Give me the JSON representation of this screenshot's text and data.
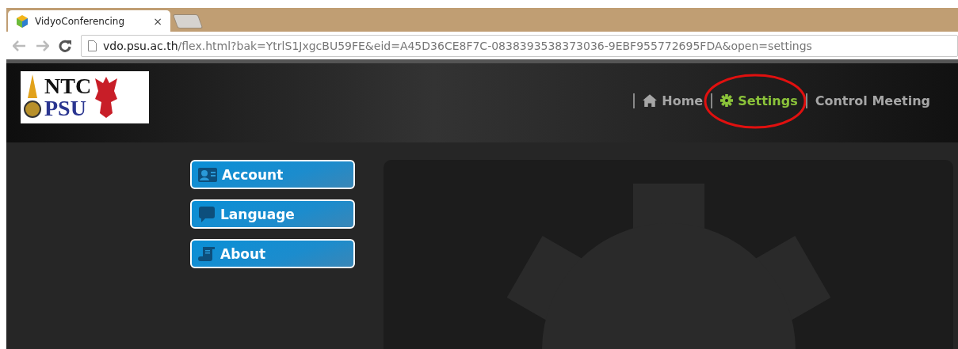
{
  "browser": {
    "tab_title": "VidyoConferencing",
    "tab_close": "×",
    "url_host": "vdo.psu.ac.th",
    "url_path": "/flex.html?bak=YtrlS1JxgcBU59FE&eid=A45D36CE8F7C-0838393538373036-9EBF955772695FDA&open=settings"
  },
  "logo": {
    "line_1": "NTC",
    "line_2": "PSU"
  },
  "nav": [
    {
      "label": "Home",
      "kind": "home",
      "selected": false,
      "circled": false
    },
    {
      "label": "Settings",
      "kind": "settings",
      "selected": true,
      "circled": true
    },
    {
      "label": "Control Meeting",
      "kind": "plain",
      "selected": false,
      "circled": false
    }
  ],
  "menu": [
    {
      "label": "Account",
      "kind": "account"
    },
    {
      "label": "Language",
      "kind": "language"
    },
    {
      "label": "About",
      "kind": "about"
    }
  ]
}
